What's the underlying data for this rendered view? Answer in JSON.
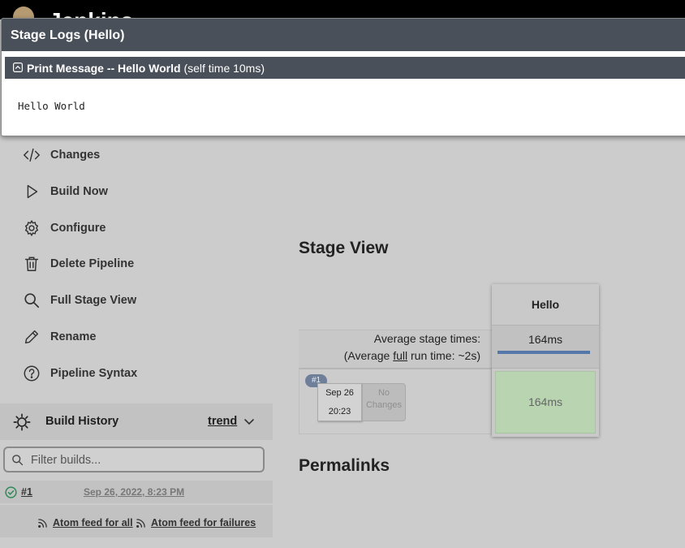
{
  "header": {
    "brand": "Jenkins"
  },
  "sidebar": {
    "tasks": [
      {
        "label": "Changes",
        "icon": "code-icon"
      },
      {
        "label": "Build Now",
        "icon": "play-icon"
      },
      {
        "label": "Configure",
        "icon": "gear-icon"
      },
      {
        "label": "Delete Pipeline",
        "icon": "trash-icon"
      },
      {
        "label": "Full Stage View",
        "icon": "search-icon"
      },
      {
        "label": "Rename",
        "icon": "pencil-icon"
      },
      {
        "label": "Pipeline Syntax",
        "icon": "help-icon"
      }
    ],
    "build_history": {
      "title": "Build History",
      "trend": "trend",
      "filter_placeholder": "Filter builds...",
      "builds": [
        {
          "number": "#1",
          "date": "Sep 26, 2022, 8:23 PM",
          "status": "success"
        }
      ],
      "feed_all": "Atom feed for all",
      "feed_failures": "Atom feed for failures"
    }
  },
  "main": {
    "stage_view_title": "Stage View",
    "avg_stage_times": "Average stage times:",
    "avg_full_prefix": "(Average ",
    "avg_full_word": "full",
    "avg_full_suffix": " run time: ~2s)",
    "stages": [
      {
        "name": "Hello",
        "avg": "164ms"
      }
    ],
    "runs": [
      {
        "badge": "#1",
        "date": "Sep 26",
        "time": "20:23",
        "changes": "No Changes",
        "cells": [
          "164ms"
        ]
      }
    ],
    "permalinks_title": "Permalinks"
  },
  "modal": {
    "title": "Stage Logs (Hello)",
    "step_label": "Print Message -- Hello World",
    "step_time": "(self time 10ms)",
    "log": "Hello World"
  },
  "colors": {
    "success": "#2e8b57",
    "stage_cell": "#b8d4b0",
    "progress": "#5577aa",
    "header_dark": "#4a5059"
  }
}
